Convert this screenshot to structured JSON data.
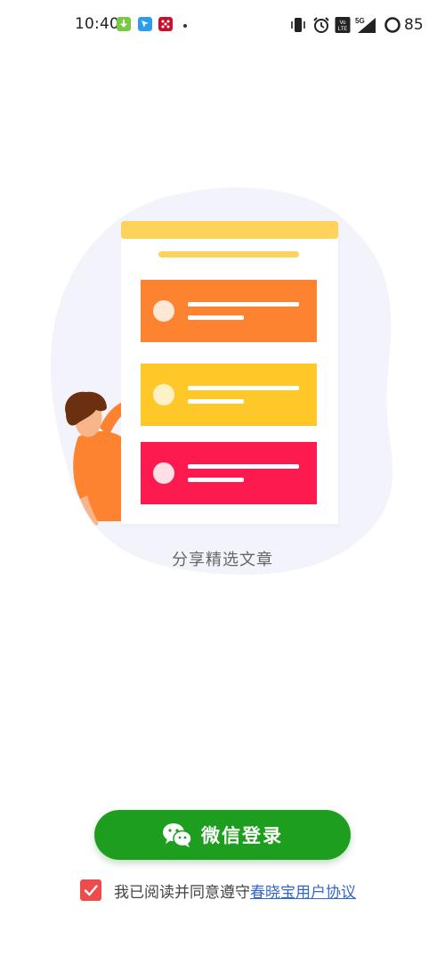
{
  "status_bar": {
    "time": "10:40",
    "network": "5G",
    "volte": "Vo LTE",
    "battery": "85"
  },
  "main": {
    "caption": "分享精选文章"
  },
  "login": {
    "wechat_label": "微信登录"
  },
  "agreement": {
    "checked": true,
    "text": "我已阅读并同意遵守",
    "link": "春晓宝用户协议"
  },
  "colors": {
    "wechat_green": "#1e9e1e",
    "checkbox_red": "#ee4b4b",
    "link_blue": "#3366cc",
    "card_orange": "#fd8331",
    "card_yellow": "#fdc828",
    "card_red": "#fc1a4f"
  }
}
